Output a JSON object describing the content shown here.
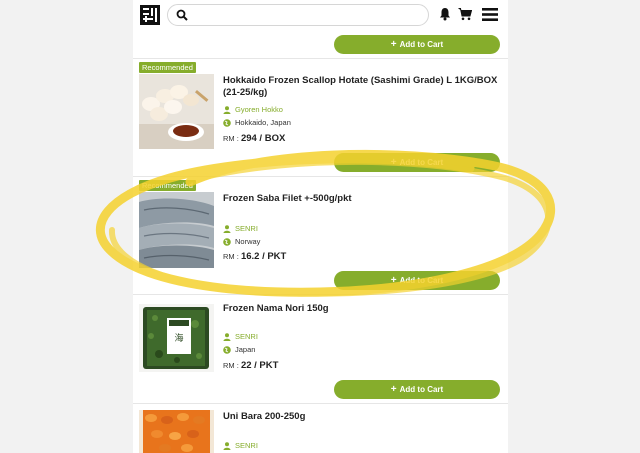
{
  "header": {
    "search_placeholder": "",
    "icons": [
      "logo-icon",
      "search-icon",
      "bell-icon",
      "cart-icon",
      "menu-icon"
    ]
  },
  "actions": {
    "add_to_cart": "Add to Cart"
  },
  "products": [
    {
      "badge": "Recommended",
      "title": "Hokkaido Frozen Scallop Hotate (Sashimi Grade) L 1KG/BOX (21-25/kg)",
      "seller": "Gyoren Hokko",
      "origin": "Hokkaido, Japan",
      "price_prefix": "RM :",
      "price": "294 / BOX"
    },
    {
      "badge": "Recommended",
      "title": "Frozen Saba Filet +-500g/pkt",
      "seller": "SENRI",
      "origin": "Norway",
      "price_prefix": "RM :",
      "price": "16.2 / PKT"
    },
    {
      "badge": "",
      "title": "Frozen Nama Nori 150g",
      "seller": "SENRI",
      "origin": "Japan",
      "price_prefix": "RM :",
      "price": "22 / PKT"
    },
    {
      "badge": "",
      "title": "Uni Bara 200-250g",
      "seller": "SENRI",
      "origin": "",
      "price_prefix": "",
      "price": ""
    }
  ],
  "colors": {
    "accent": "#86ad2c",
    "highlight": "#f5d22e"
  }
}
